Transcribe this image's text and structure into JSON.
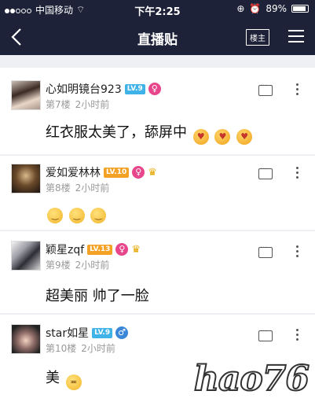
{
  "status": {
    "carrier": "中国移动",
    "time": "下午2:25",
    "battery": "89%"
  },
  "nav": {
    "title": "直播贴",
    "louzhu": "楼主"
  },
  "posts": [
    {
      "username": "心如明镜台923",
      "level": "LV.9",
      "gender": "♀",
      "floor": "第7楼",
      "time": "2小时前",
      "text": "红衣服太美了，舔屏中"
    },
    {
      "username": "爱如爱林林",
      "level": "LV.10",
      "gender": "♀",
      "floor": "第8楼",
      "time": "2小时前",
      "text": ""
    },
    {
      "username": "颖星zqf",
      "level": "LV.13",
      "gender": "♀",
      "floor": "第9楼",
      "time": "2小时前",
      "text": "超美丽 帅了一脸"
    },
    {
      "username": "star如星",
      "level": "LV.9",
      "gender": "♂",
      "floor": "第10楼",
      "time": "2小时前",
      "text": "美"
    }
  ],
  "colors": {
    "header": "#1e2238",
    "level_blue": "#3fb3e8",
    "level_orange": "#f3a225",
    "female": "#e8468b",
    "male": "#3a86d9"
  },
  "watermark": "hao76"
}
